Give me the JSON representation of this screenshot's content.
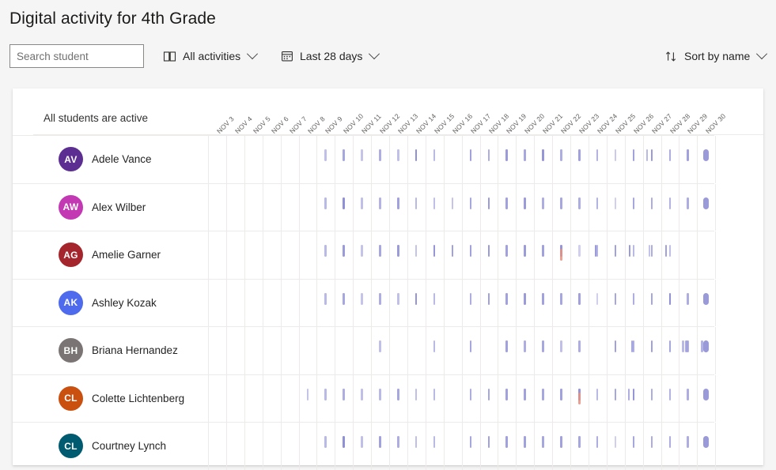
{
  "header": {
    "title": "Digital activity for 4th Grade"
  },
  "toolbar": {
    "search": {
      "placeholder": "Search student",
      "value": ""
    },
    "activities_filter": {
      "label": "All activities",
      "icon": "book-icon"
    },
    "date_range_filter": {
      "label": "Last 28 days",
      "icon": "calendar-icon"
    },
    "sort": {
      "label": "Sort by name",
      "icon": "sort-arrows-icon"
    }
  },
  "panel": {
    "status_note": "All students are active",
    "columns": [
      "NOV 3",
      "NOV 4",
      "NOV 5",
      "NOV 6",
      "NOV 7",
      "NOV 8",
      "NOV 9",
      "NOV 10",
      "NOV 11",
      "NOV 12",
      "NOV 13",
      "NOV 14",
      "NOV 15",
      "NOV 16",
      "NOV 17",
      "NOV 18",
      "NOV 19",
      "NOV 20",
      "NOV 21",
      "NOV 22",
      "NOV 23",
      "NOV 24",
      "NOV 25",
      "NOV 26",
      "NOV 27",
      "NOV 28",
      "NOV 29",
      "NOV 30"
    ],
    "students": [
      {
        "name": "Adele Vance",
        "initials": "AV",
        "avatar_color": "#5c2e91",
        "activity": [
          [],
          [],
          [],
          [],
          [],
          [],
          [
            {
              "o": 0.55
            }
          ],
          [
            {
              "o": 0.75
            }
          ],
          [
            {
              "o": 0.5
            }
          ],
          [
            {
              "o": 0.7
            }
          ],
          [
            {
              "o": 0.55
            }
          ],
          [
            {
              "o": 0.95
            }
          ],
          [
            {
              "o": 0.6
            }
          ],
          [],
          [
            {
              "o": 0.8
            }
          ],
          [
            {
              "o": 0.7
            }
          ],
          [
            {
              "o": 0.85
            }
          ],
          [
            {
              "o": 0.75
            }
          ],
          [
            {
              "o": 0.9
            }
          ],
          [
            {
              "o": 0.7
            }
          ],
          [
            {
              "o": 0.8
            }
          ],
          [
            {
              "o": 0.65
            }
          ],
          [
            {
              "o": 0.45
            }
          ],
          [
            {
              "o": 0.8
            }
          ],
          [
            {
              "o": 0.85
            },
            {
              "o": 0.6,
              "x": 4
            }
          ],
          [
            {
              "o": 0.7
            }
          ],
          [
            {
              "o": 0.8
            }
          ]
        ],
        "final_pill": true
      },
      {
        "name": "Alex Wilber",
        "initials": "AW",
        "avatar_color": "#c239b3",
        "activity": [
          [],
          [],
          [],
          [],
          [],
          [],
          [
            {
              "o": 0.6
            }
          ],
          [
            {
              "o": 0.95
            }
          ],
          [
            {
              "o": 0.55
            }
          ],
          [
            {
              "o": 0.65
            }
          ],
          [
            {
              "o": 0.8
            }
          ],
          [
            {
              "o": 0.6
            }
          ],
          [
            {
              "o": 0.55
            }
          ],
          [
            {
              "o": 0.5
            }
          ],
          [
            {
              "o": 0.75
            }
          ],
          [
            {
              "o": 0.85
            }
          ],
          [
            {
              "o": 0.8
            }
          ],
          [
            {
              "o": 0.85
            }
          ],
          [
            {
              "o": 0.7
            }
          ],
          [
            {
              "o": 0.75
            }
          ],
          [
            {
              "o": 0.7
            }
          ],
          [
            {
              "o": 0.65
            }
          ],
          [
            {
              "o": 0.4
            }
          ],
          [
            {
              "o": 0.75
            }
          ],
          [
            {
              "o": 0.7
            }
          ],
          [
            {
              "o": 0.65
            }
          ],
          [
            {
              "o": 0.7
            }
          ]
        ],
        "final_pill": true
      },
      {
        "name": "Amelie Garner",
        "initials": "AG",
        "avatar_color": "#a4262c",
        "activity": [
          [],
          [],
          [],
          [],
          [],
          [],
          [
            {
              "o": 0.6
            }
          ],
          [
            {
              "o": 0.85
            }
          ],
          [
            {
              "o": 0.5
            }
          ],
          [
            {
              "o": 0.75
            }
          ],
          [
            {
              "o": 0.85
            }
          ],
          [
            {
              "o": 0.5
            }
          ],
          [
            {
              "o": 0.9
            }
          ],
          [
            {
              "o": 0.8
            }
          ],
          [
            {
              "o": 0.8
            }
          ],
          [
            {
              "o": 0.85
            }
          ],
          [
            {
              "o": 0.8
            }
          ],
          [
            {
              "o": 0.85
            }
          ],
          [
            {
              "o": 0.8
            }
          ],
          [
            {
              "o": 0.9
            },
            {
              "o": 0.85,
              "alert": true,
              "y": 22
            }
          ],
          [
            {
              "o": 0.4
            }
          ],
          [
            {
              "o": 0.65
            },
            {
              "o": 0.85,
              "x": 8
            }
          ],
          [
            {
              "o": 0.8
            }
          ],
          [
            {
              "o": 0.6
            },
            {
              "o": 0.85,
              "x": 5
            }
          ],
          [
            {
              "o": 0.7
            },
            {
              "o": 0.5,
              "x": 7
            }
          ],
          [
            {
              "o": 0.55
            },
            {
              "o": 0.8,
              "x": 5
            }
          ],
          []
        ],
        "final_pill": false
      },
      {
        "name": "Ashley Kozak",
        "initials": "AK",
        "avatar_color": "#4f6bed",
        "activity": [
          [],
          [],
          [],
          [],
          [],
          [],
          [
            {
              "o": 0.6
            }
          ],
          [
            {
              "o": 0.75
            }
          ],
          [
            {
              "o": 0.5
            }
          ],
          [
            {
              "o": 0.7
            }
          ],
          [
            {
              "o": 0.55
            }
          ],
          [
            {
              "o": 0.9
            }
          ],
          [
            {
              "o": 0.6
            }
          ],
          [],
          [
            {
              "o": 0.7
            }
          ],
          [
            {
              "o": 0.8
            }
          ],
          [
            {
              "o": 0.8
            }
          ],
          [
            {
              "o": 0.85
            }
          ],
          [
            {
              "o": 0.8
            }
          ],
          [
            {
              "o": 0.75
            }
          ],
          [
            {
              "o": 0.8
            }
          ],
          [
            {
              "o": 0.4
            }
          ],
          [
            {
              "o": 0.75
            }
          ],
          [
            {
              "o": 0.7
            }
          ],
          [
            {
              "o": 0.75
            }
          ],
          [
            {
              "o": 0.95
            }
          ],
          [
            {
              "o": 0.7
            }
          ]
        ],
        "final_pill": true
      },
      {
        "name": "Briana Hernandez",
        "initials": "BH",
        "avatar_color": "#7a7574",
        "activity": [
          [],
          [],
          [],
          [],
          [],
          [],
          [],
          [],
          [],
          [
            {
              "o": 0.55
            }
          ],
          [],
          [],
          [
            {
              "o": 0.6
            }
          ],
          [],
          [
            {
              "o": 0.75
            }
          ],
          [],
          [
            {
              "o": 0.8
            }
          ],
          [
            {
              "o": 0.7
            }
          ],
          [
            {
              "o": 0.75
            }
          ],
          [
            {
              "o": 0.55
            }
          ],
          [
            {
              "o": 0.7
            }
          ],
          [],
          [
            {
              "o": 0.8
            }
          ],
          [
            {
              "o": 0.7
            },
            {
              "o": 0.75,
              "x": 8
            }
          ],
          [
            {
              "o": 0.8
            }
          ],
          [
            {
              "o": 0.75
            }
          ],
          [
            {
              "o": 0.7
            },
            {
              "o": 0.6,
              "x": 4
            },
            {
              "o": 0.7,
              "x": 8
            }
          ],
          [
            {
              "o": 0.7
            },
            {
              "o": 0.65,
              "x": 5
            }
          ]
        ],
        "final_pill": true
      },
      {
        "name": "Colette Lichtenberg",
        "initials": "CL",
        "avatar_color": "#ca5010",
        "activity": [
          [],
          [],
          [],
          [],
          [],
          [
            {
              "o": 0.5
            }
          ],
          [
            {
              "o": 0.6
            }
          ],
          [
            {
              "o": 0.7
            }
          ],
          [
            {
              "o": 0.55
            }
          ],
          [
            {
              "o": 0.6
            }
          ],
          [
            {
              "o": 0.75
            }
          ],
          [
            {
              "o": 0.55
            }
          ],
          [
            {
              "o": 0.6
            }
          ],
          [],
          [
            {
              "o": 0.7
            }
          ],
          [
            {
              "o": 0.75
            }
          ],
          [
            {
              "o": 0.8
            }
          ],
          [
            {
              "o": 0.8
            }
          ],
          [
            {
              "o": 0.75
            }
          ],
          [
            {
              "o": 0.8
            }
          ],
          [
            {
              "o": 0.9
            },
            {
              "o": 0.85,
              "alert": true,
              "y": 22
            }
          ],
          [
            {
              "o": 0.6
            }
          ],
          [
            {
              "o": 0.75
            }
          ],
          [
            {
              "o": 0.9
            },
            {
              "o": 0.7,
              "x": 4
            }
          ],
          [
            {
              "o": 0.7
            }
          ],
          [
            {
              "o": 0.65
            }
          ],
          [
            {
              "o": 0.7
            }
          ]
        ],
        "final_pill": true
      },
      {
        "name": "Courtney Lynch",
        "initials": "CL",
        "avatar_color": "#005b70",
        "activity": [
          [],
          [],
          [],
          [],
          [],
          [],
          [
            {
              "o": 0.6
            }
          ],
          [
            {
              "o": 0.95
            }
          ],
          [
            {
              "o": 0.55
            }
          ],
          [
            {
              "o": 0.8
            }
          ],
          [
            {
              "o": 0.7
            }
          ],
          [
            {
              "o": 0.55
            }
          ],
          [
            {
              "o": 0.6
            }
          ],
          [],
          [
            {
              "o": 0.75
            }
          ],
          [
            {
              "o": 0.8
            }
          ],
          [
            {
              "o": 0.8
            }
          ],
          [
            {
              "o": 0.8
            }
          ],
          [
            {
              "o": 0.75
            }
          ],
          [
            {
              "o": 0.8
            }
          ],
          [
            {
              "o": 0.75
            }
          ],
          [
            {
              "o": 0.7
            }
          ],
          [
            {
              "o": 0.4
            }
          ],
          [
            {
              "o": 0.75
            }
          ],
          [
            {
              "o": 0.7
            }
          ],
          [
            {
              "o": 0.7
            }
          ],
          [
            {
              "o": 0.7
            }
          ]
        ],
        "final_pill": true
      }
    ]
  }
}
